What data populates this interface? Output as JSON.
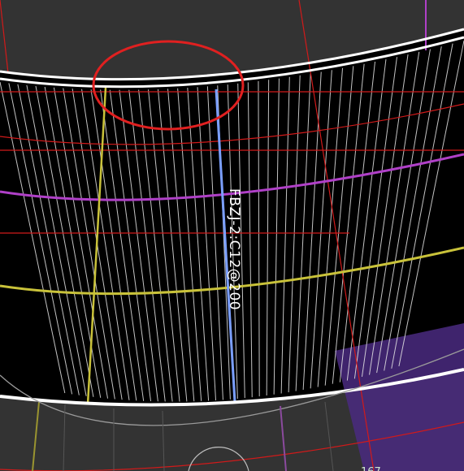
{
  "drawing": {
    "rebar_label": "FBZJ-2:C12@200",
    "partial_tag": "167"
  },
  "colors": {
    "background": "#333333",
    "slab": "#000000",
    "edge": "#ffffff",
    "rebar": "#e6e6e6",
    "highlight_rebar": "#7b9fff",
    "yellow_line": "#c9c23a",
    "magenta_line": "#b040c8",
    "red_line": "#d11a1a",
    "purple_zone": "#4a2a80",
    "annotation": "#e02020"
  },
  "icons": {
    "markup_circle": "red-ellipse-markup"
  }
}
